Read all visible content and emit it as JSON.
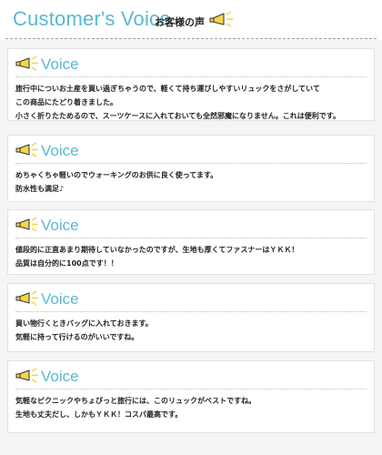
{
  "header": {
    "title": "Customer's Voice",
    "subtitle": "お客様の声",
    "icon": "megaphone-icon"
  },
  "colors": {
    "accent": "#5bb8d0",
    "megaphone_yellow": "#f2d64b",
    "text": "#222222",
    "background": "#f5f5f5"
  },
  "reviews": [
    {
      "label": "Voice",
      "icon": "megaphone-icon",
      "lines": [
        "旅行中についお土産を買い過ぎちゃうので、軽くて持ち運びしやすいリュックをさがしていて",
        "この商品にたどり着きました。",
        "小さく折りたためるので、スーツケースに入れておいても全然邪魔になりません。これは便利です。"
      ]
    },
    {
      "label": "Voice",
      "icon": "megaphone-icon",
      "lines": [
        "めちゃくちゃ軽いのでウォーキングのお供に良く使ってます。",
        "防水性も満足♪"
      ]
    },
    {
      "label": "Voice",
      "icon": "megaphone-icon",
      "lines": [
        "値段的に正直あまり期待していなかったのですが、生地も厚くてファスナーはＹＫＫ！",
        "品質は自分的に100点です！！"
      ]
    },
    {
      "label": "Voice",
      "icon": "megaphone-icon",
      "lines": [
        "買い物行くときバッグに入れておきます。",
        "気軽に持って行けるのがいいですね。"
      ]
    },
    {
      "label": "Voice",
      "icon": "megaphone-icon",
      "lines": [
        "気軽なピクニックやちょびっと旅行には、このリュックがベストですね。",
        "生地も丈夫だし、しかもＹＫＫ！コスパ最高です。"
      ]
    }
  ]
}
